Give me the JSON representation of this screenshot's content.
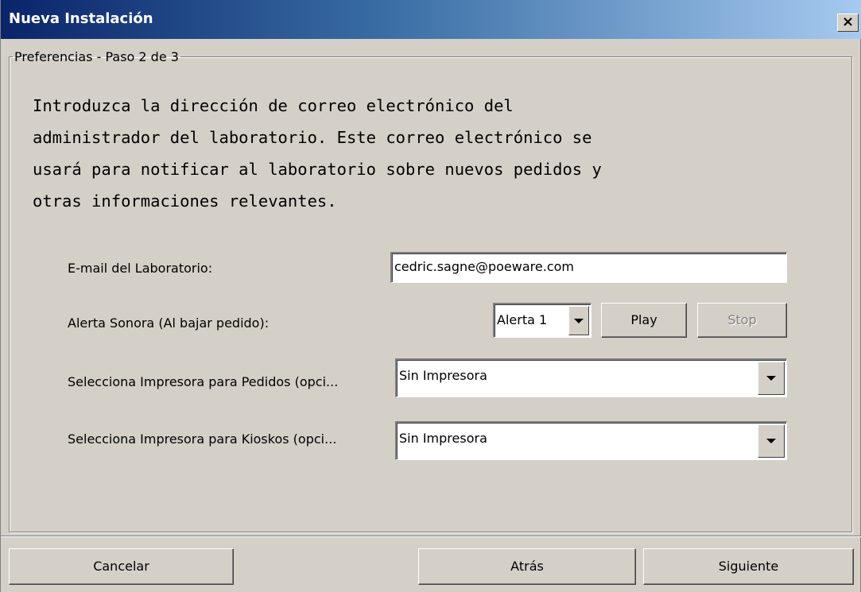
{
  "window": {
    "title": "Nueva Instalación",
    "close_label": "×"
  },
  "group": {
    "legend": "Preferencias - Paso 2 de 3",
    "description": "Introduzca la dirección de correo electrónico del\nadministrador del laboratorio. Este correo electrónico se\nusará para notificar al laboratorio sobre nuevos pedidos y\notras informaciones relevantes."
  },
  "form": {
    "email_label": "E-mail del Laboratorio:",
    "email_value": "cedric.sagne@poeware.com",
    "alert_label": "Alerta Sonora (Al bajar pedido):",
    "alert_value": "Alerta 1",
    "play_label": "Play",
    "stop_label": "Stop",
    "printer_orders_label": "Selecciona Impresora para Pedidos (opci...",
    "printer_orders_value": "Sin Impresora",
    "printer_kiosks_label": "Selecciona Impresora para Kioskos (opci...",
    "printer_kiosks_value": "Sin Impresora"
  },
  "footer": {
    "cancel_label": "Cancelar",
    "back_label": "Atrás",
    "next_label": "Siguiente"
  }
}
